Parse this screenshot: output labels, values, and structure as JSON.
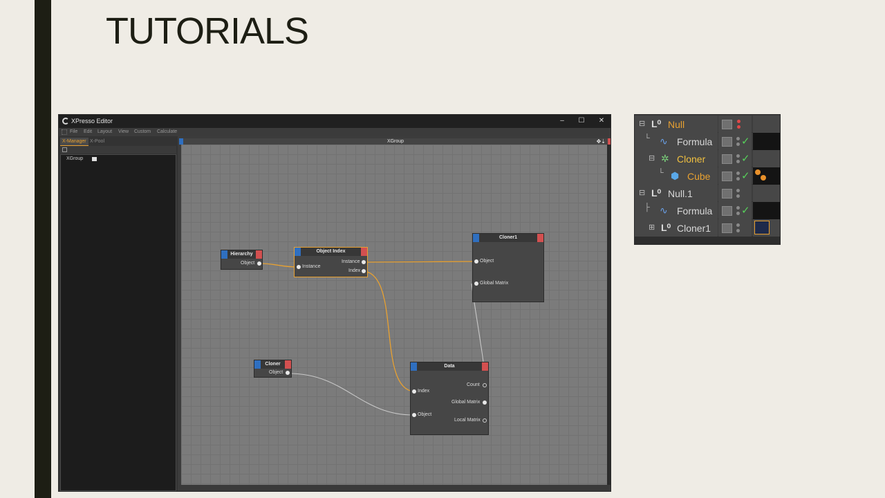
{
  "slide": {
    "title": "TUTORIALS"
  },
  "xpresso": {
    "window_title": "XPresso Editor",
    "controls": {
      "minimize": "–",
      "maximize": "☐",
      "close": "✕"
    },
    "menu": [
      "File",
      "Edit",
      "Layout",
      "View",
      "Custom",
      "Calculate"
    ],
    "tabs": {
      "xmanager": "X-Manager",
      "xpool": "X-Pool"
    },
    "tree_item": "XGroup",
    "canvas_title": "XGroup",
    "nodes": {
      "hierarchy": {
        "title": "Hierarchy",
        "out_object": "Object"
      },
      "object_index": {
        "title": "Object Index",
        "in_instance": "Instance",
        "out_instance": "Instance",
        "out_index": "Index"
      },
      "cloner1": {
        "title": "Cloner1",
        "in_object": "Object",
        "in_global_matrix": "Global Matrix"
      },
      "cloner": {
        "title": "Cloner",
        "out_object": "Object"
      },
      "data": {
        "title": "Data",
        "in_index": "Index",
        "in_object": "Object",
        "out_count": "Count",
        "out_global_matrix": "Global Matrix",
        "out_local_matrix": "Local Matrix"
      }
    },
    "colors": {
      "wire_active": "#e8a131",
      "wire_inactive": "#c8c8c8",
      "port_in": "#2f6fc0",
      "port_out": "#d35050"
    }
  },
  "object_manager": {
    "rows": [
      {
        "name": "Null",
        "color": "#e8a131",
        "icon": "null-icon"
      },
      {
        "name": "Formula",
        "color": "#d8d8d8",
        "icon": "formula-icon"
      },
      {
        "name": "Cloner",
        "color": "#f0c040",
        "icon": "cloner-icon"
      },
      {
        "name": "Cube",
        "color": "#e8a131",
        "icon": "cube-icon"
      },
      {
        "name": "Null.1",
        "color": "#d8d8d8",
        "icon": "null-icon"
      },
      {
        "name": "Formula",
        "color": "#d8d8d8",
        "icon": "formula-icon"
      },
      {
        "name": "Cloner1",
        "color": "#d8d8d8",
        "icon": "null-icon"
      }
    ]
  }
}
